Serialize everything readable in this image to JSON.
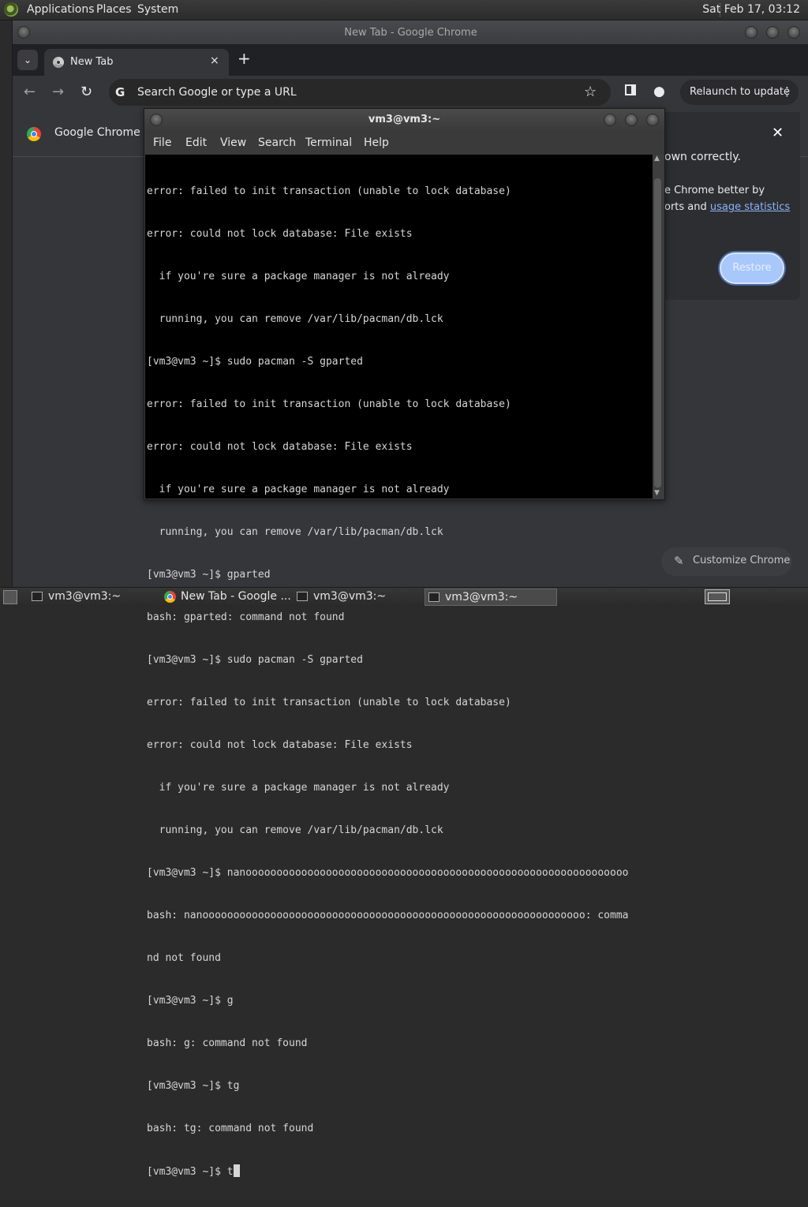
{
  "top_panel": {
    "menus": [
      "Applications",
      "Places",
      "System"
    ],
    "clock": "Sat Feb 17, 03:12"
  },
  "chrome": {
    "window_title": "New Tab - Google Chrome",
    "tab_title": "New Tab",
    "tab_close": "×",
    "new_tab": "+",
    "tab_list": "⌄",
    "back": "←",
    "forward": "→",
    "reload": "↻",
    "omnibox_placeholder": "Search Google or type a URL",
    "omnibox_g": "G",
    "star": "☆",
    "relaunch_label": "Relaunch to update",
    "relaunch_menu": "⋮",
    "infobar_text": "Google Chrome isn",
    "dialog": {
      "close": "✕",
      "line1": "own correctly.",
      "line2": "e Chrome better by",
      "line3_prefix": "orts and ",
      "line3_link": "usage statistics",
      "restore_label": "Restore"
    },
    "customize_label": "Customize Chrome",
    "customize_icon": "✎"
  },
  "terminal": {
    "title": "vm3@vm3:~",
    "menus": [
      "File",
      "Edit",
      "View",
      "Search",
      "Terminal",
      "Help"
    ],
    "lines": [
      "error: failed to init transaction (unable to lock database)",
      "error: could not lock database: File exists",
      "  if you're sure a package manager is not already",
      "  running, you can remove /var/lib/pacman/db.lck",
      "[vm3@vm3 ~]$ sudo pacman -S gparted",
      "error: failed to init transaction (unable to lock database)",
      "error: could not lock database: File exists",
      "  if you're sure a package manager is not already",
      "  running, you can remove /var/lib/pacman/db.lck",
      "[vm3@vm3 ~]$ gparted",
      "bash: gparted: command not found",
      "[vm3@vm3 ~]$ sudo pacman -S gparted",
      "error: failed to init transaction (unable to lock database)",
      "error: could not lock database: File exists",
      "  if you're sure a package manager is not already",
      "  running, you can remove /var/lib/pacman/db.lck",
      "[vm3@vm3 ~]$ nanoooooooooooooooooooooooooooooooooooooooooooooooooooooooooooooo",
      "bash: nanoooooooooooooooooooooooooooooooooooooooooooooooooooooooooooooo: comma",
      "nd not found",
      "[vm3@vm3 ~]$ g",
      "bash: g: command not found",
      "[vm3@vm3 ~]$ tg",
      "bash: tg: command not found"
    ],
    "current_prompt": "[vm3@vm3 ~]$ t"
  },
  "taskbar": {
    "items": [
      "vm3@vm3:~",
      "New Tab - Google ...",
      "vm3@vm3:~",
      "vm3@vm3:~"
    ]
  }
}
